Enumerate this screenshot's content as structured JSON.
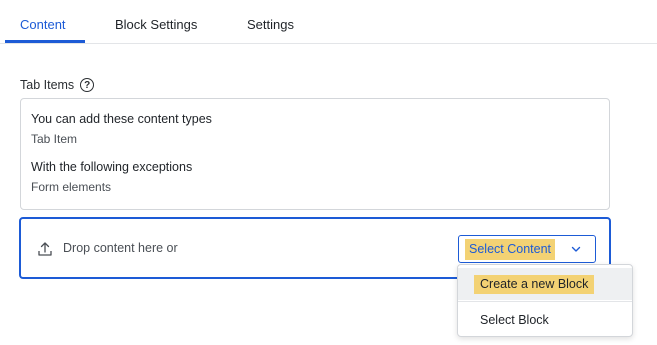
{
  "tabs": [
    {
      "label": "Content"
    },
    {
      "label": "Block Settings"
    },
    {
      "label": "Settings"
    }
  ],
  "section": {
    "label": "Tab Items",
    "help_icon": "question-circle-icon"
  },
  "info": {
    "allowed_title": "You can add these content types",
    "allowed_item": "Tab Item",
    "exceptions_title": "With the following exceptions",
    "exceptions_item": "Form elements"
  },
  "dropzone": {
    "icon": "upload-icon",
    "text": "Drop content here or",
    "select_label": "Select Content",
    "chevron": "chevron-down-icon"
  },
  "menu": {
    "items": [
      {
        "label": "Create a new Block"
      },
      {
        "label": "Select Block"
      }
    ]
  },
  "colors": {
    "accent": "#1d5bd6",
    "highlight": "#f3d274"
  }
}
